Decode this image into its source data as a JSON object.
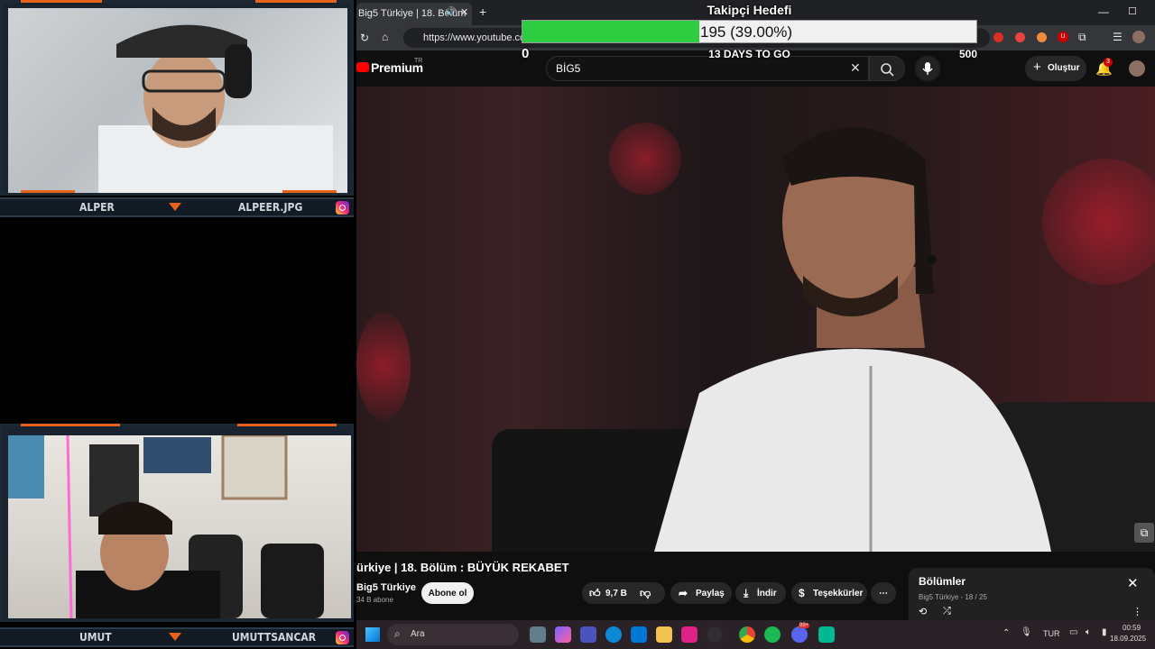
{
  "cams": {
    "top": {
      "name_left": "ALPER",
      "name_right": "ALPEER.JPG"
    },
    "bottom": {
      "name_left": "UMUT",
      "name_right": "UMUTTSANCAR"
    }
  },
  "browser": {
    "tab_title": "Big5 Türkiye | 18. Bölüm",
    "url": "https://www.youtube.com",
    "extension_badge": "0"
  },
  "youtube": {
    "brand": "Premium",
    "brand_sup": "TR",
    "search_value": "BİG5",
    "create_label": "Oluştur",
    "notif_count": "3",
    "video_title": "ürkiye | 18. Bölüm : BÜYÜK REKABET",
    "channel": "Big5 Türkiye",
    "subscribers": "34 B abone",
    "subscribe_label": "Abone ol",
    "likes": "9,7 B",
    "share_label": "Paylaş",
    "download_label": "İndir",
    "thanks_label": "Teşekkürler",
    "playlist_title": "Bölümler",
    "playlist_sub": "Big5 Türkiye - 18 / 25"
  },
  "goal_overlay": {
    "title": "Takipçi Hedefi",
    "current": "195 (39.00%)",
    "progress": 0.39,
    "min": "0",
    "max": "500",
    "days": "13 DAYS TO GO",
    "colors": {
      "fill": "#2ecc40",
      "track": "#f0f0f0"
    }
  },
  "taskbar": {
    "search_placeholder": "Ara",
    "lang": "TUR",
    "time": "00:59",
    "date": "18.09.2025",
    "discord_badge": "99+"
  }
}
